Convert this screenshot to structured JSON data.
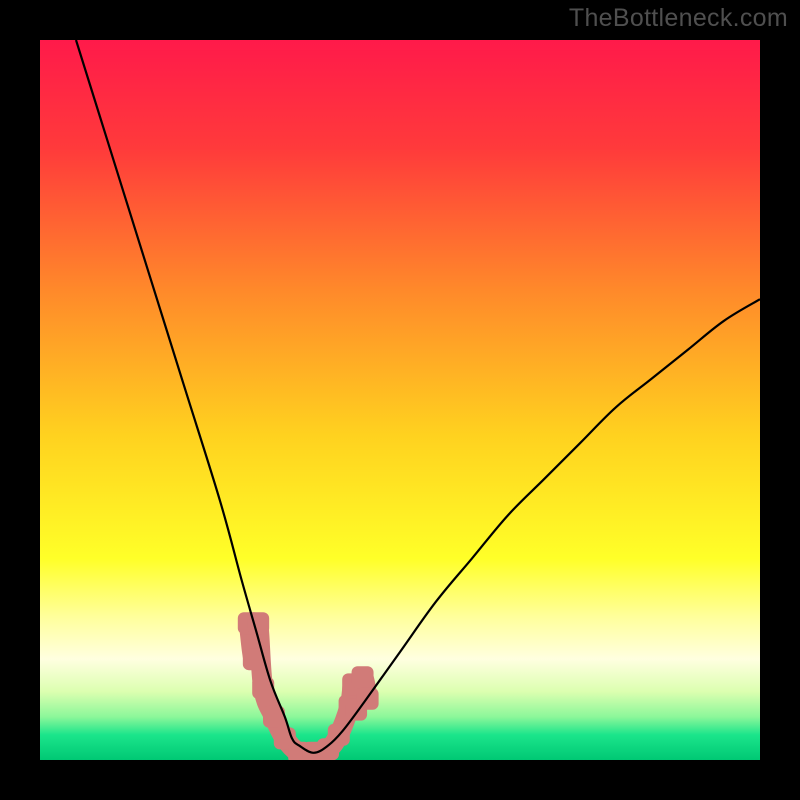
{
  "watermark": "TheBottleneck.com",
  "chart_data": {
    "type": "line",
    "title": "",
    "xlabel": "",
    "ylabel": "",
    "xlim": [
      0,
      100
    ],
    "ylim": [
      0,
      100
    ],
    "background_gradient_stops": [
      {
        "pos": 0.0,
        "color": "#ff1a4a"
      },
      {
        "pos": 0.15,
        "color": "#ff3a3b"
      },
      {
        "pos": 0.35,
        "color": "#ff8a2a"
      },
      {
        "pos": 0.55,
        "color": "#ffd21f"
      },
      {
        "pos": 0.72,
        "color": "#ffff28"
      },
      {
        "pos": 0.8,
        "color": "#ffff9a"
      },
      {
        "pos": 0.86,
        "color": "#ffffe0"
      },
      {
        "pos": 0.905,
        "color": "#dcffb0"
      },
      {
        "pos": 0.94,
        "color": "#8cf79a"
      },
      {
        "pos": 0.965,
        "color": "#1be58b"
      },
      {
        "pos": 1.0,
        "color": "#00c874"
      }
    ],
    "series": [
      {
        "name": "bottleneck-curve",
        "color": "#000000",
        "width": 2.2,
        "x": [
          5,
          10,
          15,
          20,
          25,
          28,
          30,
          32,
          34,
          35,
          36,
          38,
          40,
          42,
          45,
          50,
          55,
          60,
          65,
          70,
          75,
          80,
          85,
          90,
          95,
          100
        ],
        "y": [
          100,
          84,
          68,
          52,
          36,
          25,
          18,
          11,
          6,
          3,
          2,
          1,
          2,
          4,
          8,
          15,
          22,
          28,
          34,
          39,
          44,
          49,
          53,
          57,
          61,
          64
        ]
      }
    ],
    "highlight_band": {
      "name": "optimal-range",
      "color": "#d17b78",
      "alpha": 1.0,
      "points": [
        {
          "x": 29,
          "y": 19
        },
        {
          "x": 29.7,
          "y": 14
        },
        {
          "x": 30.3,
          "y": 19
        },
        {
          "x": 31,
          "y": 10
        },
        {
          "x": 32.5,
          "y": 6
        },
        {
          "x": 34,
          "y": 3
        },
        {
          "x": 36,
          "y": 1
        },
        {
          "x": 38,
          "y": 1
        },
        {
          "x": 40,
          "y": 1.5
        },
        {
          "x": 41.5,
          "y": 3.5
        },
        {
          "x": 43,
          "y": 7.5
        },
        {
          "x": 43.5,
          "y": 10.5
        },
        {
          "x": 43.9,
          "y": 7
        },
        {
          "x": 44.8,
          "y": 11.5
        },
        {
          "x": 45.5,
          "y": 8.5
        }
      ]
    }
  }
}
